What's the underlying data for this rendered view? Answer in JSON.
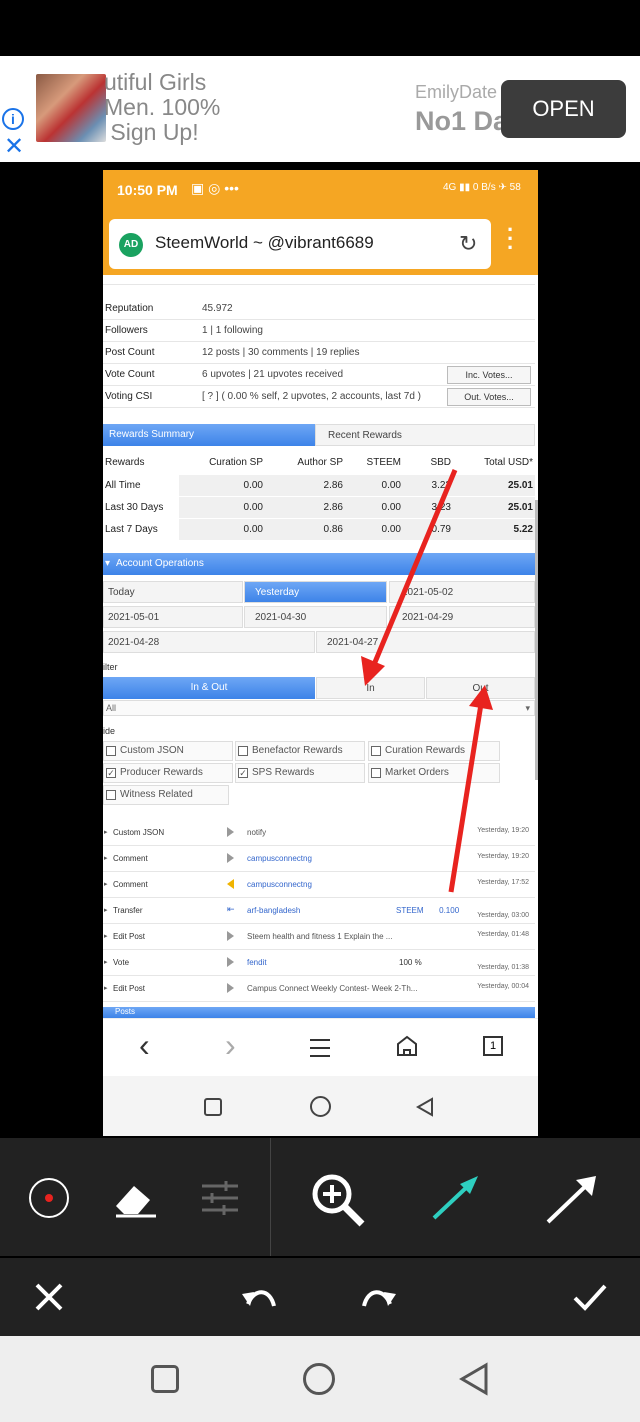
{
  "ad": {
    "text": "utiful Girls\nMen. 100%\n Sign Up!",
    "brand": "EmilyDate",
    "brand2": "No1 Da",
    "open_label": "OPEN",
    "info_icon": "i",
    "close_icon": "✕"
  },
  "status": {
    "time": "10:50 PM",
    "icons": "▣ ◎ •••",
    "right": "4G ▮▮ 0 B/s ✈ 58"
  },
  "browser": {
    "badge": "AD",
    "title": "SteemWorld ~ @vibrant6689",
    "reload_icon": "↻",
    "menu_icon": "⋮"
  },
  "profile": {
    "rows": [
      {
        "key": "Reputation",
        "value": "45.972"
      },
      {
        "key": "Followers",
        "value": "1  |  1 following"
      },
      {
        "key": "Post Count",
        "value": "12 posts  |  30 comments  |  19 replies"
      },
      {
        "key": "Vote Count",
        "value": "6 upvotes  |  21 upvotes received",
        "btn": "Inc. Votes..."
      },
      {
        "key": "Voting CSI",
        "value": "[ ? ] ( 0.00 % self, 2 upvotes, 2 accounts, last 7d )",
        "btn": "Out. Votes..."
      }
    ]
  },
  "rewards": {
    "tab_active": "Rewards Summary",
    "tab_inactive": "Recent Rewards",
    "headers": [
      "Rewards",
      "Curation SP",
      "Author SP",
      "STEEM",
      "SBD",
      "Total USD*"
    ],
    "rows": [
      [
        "All Time",
        "0.00",
        "2.86",
        "0.00",
        "3.23",
        "25.01"
      ],
      [
        "Last 30 Days",
        "0.00",
        "2.86",
        "0.00",
        "3.23",
        "25.01"
      ],
      [
        "Last 7 Days",
        "0.00",
        "0.86",
        "0.00",
        "0.79",
        "5.22"
      ]
    ]
  },
  "operations": {
    "title": "Account Operations",
    "dates": [
      "Today",
      "Yesterday",
      "2021-05-02",
      "2021-05-01",
      "2021-04-30",
      "2021-04-29",
      "2021-04-28",
      "2021-04-27"
    ],
    "filter_label": "ilter",
    "filter_tabs": [
      "In & Out",
      "In",
      "Out"
    ],
    "select_value": "All",
    "hide_label": "ide",
    "checks": [
      {
        "label": "Custom JSON",
        "checked": false
      },
      {
        "label": "Benefactor Rewards",
        "checked": false
      },
      {
        "label": "Curation Rewards",
        "checked": false
      },
      {
        "label": "Producer Rewards",
        "checked": true
      },
      {
        "label": "SPS Rewards",
        "checked": true
      },
      {
        "label": "Market Orders",
        "checked": false
      },
      {
        "label": "Witness Related",
        "checked": false
      }
    ],
    "items": [
      {
        "type": "Custom JSON",
        "detail": "notify",
        "link": false,
        "time": "Yesterday, 19:20"
      },
      {
        "type": "Comment",
        "detail": "campusconnectng",
        "link": true,
        "time": "Yesterday, 19:20"
      },
      {
        "type": "Comment",
        "detail": "campusconnectng",
        "link": true,
        "time": "Yesterday, 17:52"
      },
      {
        "type": "Transfer",
        "detail": "arf-bangladesh",
        "link": true,
        "extra": "STEEM       0.100",
        "time": "Yesterday, 03:00"
      },
      {
        "type": "Edit Post",
        "detail": "Steem health and fitness 1 Explain the ...",
        "link": false,
        "time": "Yesterday, 01:48"
      },
      {
        "type": "Vote",
        "detail": "fendit",
        "link": true,
        "extra": "100 %",
        "time": "Yesterday, 01:38"
      },
      {
        "type": "Edit Post",
        "detail": "Campus Connect Weekly Contest- Week 2-Th...",
        "link": false,
        "time": "Yesterday, 00:04"
      }
    ],
    "next_bar": "Posts"
  },
  "browser_nav": {
    "back": "‹",
    "forward": "›",
    "tabs_count": "1"
  },
  "colors": {
    "accent_orange": "#f5a623",
    "blue_bar": "#3d83e8",
    "arrow_red": "#e8231f",
    "teal_pen": "#2ecfc0"
  }
}
